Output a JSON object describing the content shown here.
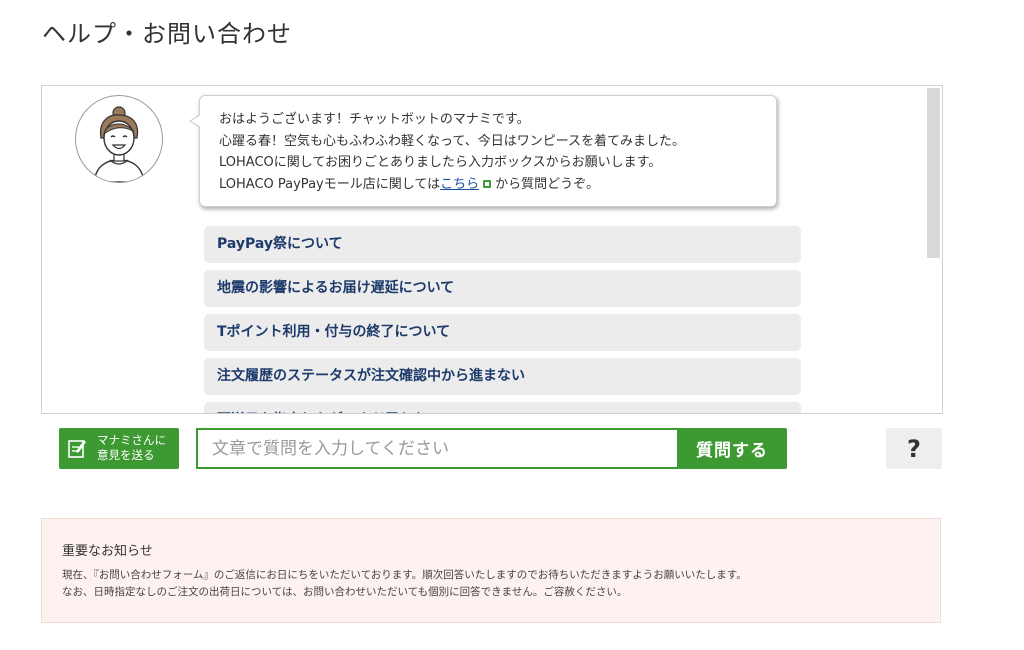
{
  "page": {
    "title": "ヘルプ・お問い合わせ"
  },
  "chat": {
    "bot_message": {
      "line1": "おはようございます！チャットボットのマナミです。",
      "line2": "心躍る春！空気も心もふわふわ軽くなって、今日はワンピースを着てみました。",
      "line3": "LOHACOに関してお困りごとありましたら入力ボックスからお願いします。",
      "line4_prefix": "LOHACO PayPayモール店に関しては",
      "line4_link": "こちら",
      "line4_suffix": "から質問どうぞ。"
    },
    "options": [
      {
        "label": "PayPay祭について"
      },
      {
        "label": "地震の影響によるお届け遅延について"
      },
      {
        "label": "Tポイント利用・付与の終了について"
      },
      {
        "label": "注文履歴のステータスが注文確認中から進まない"
      },
      {
        "label": "配送日を指定したが、まだ届かない"
      }
    ]
  },
  "input_bar": {
    "feedback_line1": "マナミさんに",
    "feedback_line2": "意見を送る",
    "placeholder": "文章で質問を入力してください",
    "ask_label": "質問する",
    "help_label": "?"
  },
  "notice": {
    "title": "重要なお知らせ",
    "line1": "現在、『お問い合わせフォーム』のご返信にお日にちをいただいております。順次回答いたしますのでお待ちいただきますようお願いいたします。",
    "line2": "なお、日時指定なしのご注文の出荷日については、お問い合わせいただいても個別に回答できません。ご容赦ください。"
  },
  "colors": {
    "accent_green": "#3d9932",
    "option_text": "#1d3a6b",
    "notice_bg": "#fdf2ef"
  }
}
